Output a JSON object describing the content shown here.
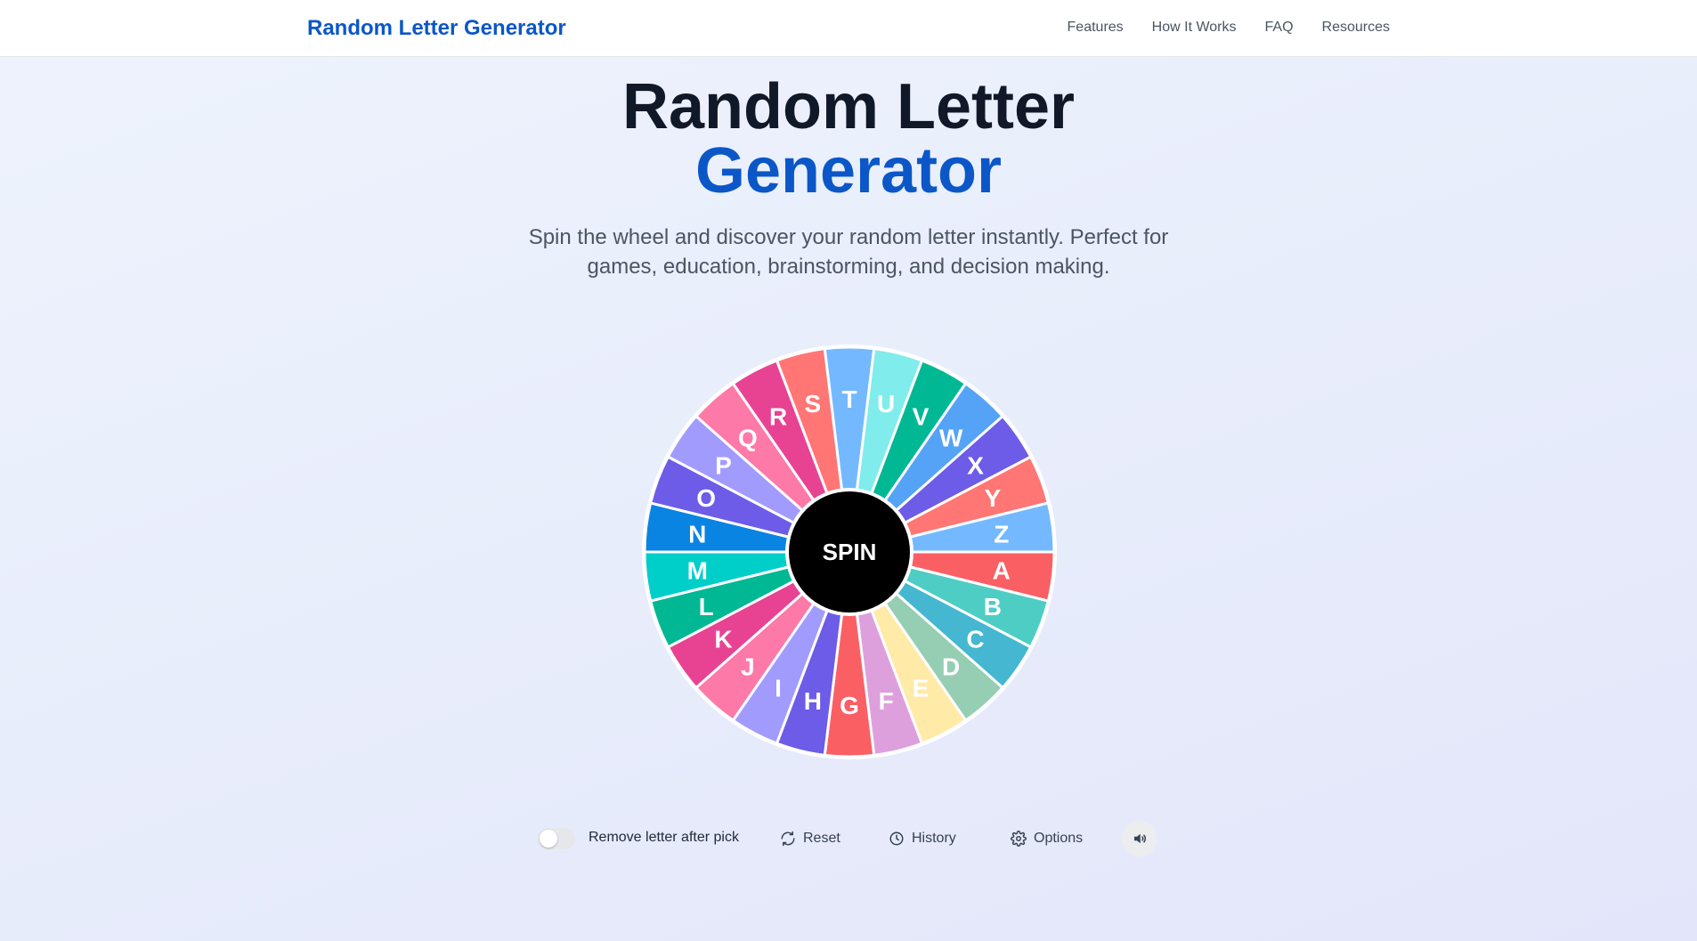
{
  "header": {
    "brand": "Random Letter Generator",
    "nav": [
      "Features",
      "How It Works",
      "FAQ",
      "Resources"
    ]
  },
  "hero": {
    "title_line1": "Random Letter",
    "title_line2": "Generator",
    "subtitle": "Spin the wheel and discover your random letter instantly. Perfect for games, education, brainstorming, and decision making."
  },
  "wheel": {
    "center_label": "SPIN",
    "start_letter_at_top": "T",
    "segments": [
      {
        "letter": "A",
        "color": "#fa5f64"
      },
      {
        "letter": "B",
        "color": "#4ecdc4"
      },
      {
        "letter": "C",
        "color": "#45b7d1"
      },
      {
        "letter": "D",
        "color": "#96ceb4"
      },
      {
        "letter": "E",
        "color": "#ffeaa7"
      },
      {
        "letter": "F",
        "color": "#dda0dd"
      },
      {
        "letter": "G",
        "color": "#fa5f64"
      },
      {
        "letter": "H",
        "color": "#6c5ce7"
      },
      {
        "letter": "I",
        "color": "#a29bfe"
      },
      {
        "letter": "J",
        "color": "#fd79a8"
      },
      {
        "letter": "K",
        "color": "#e84393"
      },
      {
        "letter": "L",
        "color": "#00b894"
      },
      {
        "letter": "M",
        "color": "#00cec9"
      },
      {
        "letter": "N",
        "color": "#0984e3"
      },
      {
        "letter": "O",
        "color": "#6c5ce7"
      },
      {
        "letter": "P",
        "color": "#a29bfe"
      },
      {
        "letter": "Q",
        "color": "#fd79a8"
      },
      {
        "letter": "R",
        "color": "#e84393"
      },
      {
        "letter": "S",
        "color": "#ff7675"
      },
      {
        "letter": "T",
        "color": "#74b9ff"
      },
      {
        "letter": "U",
        "color": "#81ecec"
      },
      {
        "letter": "V",
        "color": "#00b894"
      },
      {
        "letter": "W",
        "color": "#55a3f7"
      },
      {
        "letter": "X",
        "color": "#6c5ce7"
      },
      {
        "letter": "Y",
        "color": "#ff7675"
      },
      {
        "letter": "Z",
        "color": "#74b9ff"
      }
    ]
  },
  "controls": {
    "toggle_label": "Remove letter after pick",
    "toggle_on": false,
    "reset": "Reset",
    "history": "History",
    "options": "Options",
    "sound_icon": "speaker-icon"
  }
}
